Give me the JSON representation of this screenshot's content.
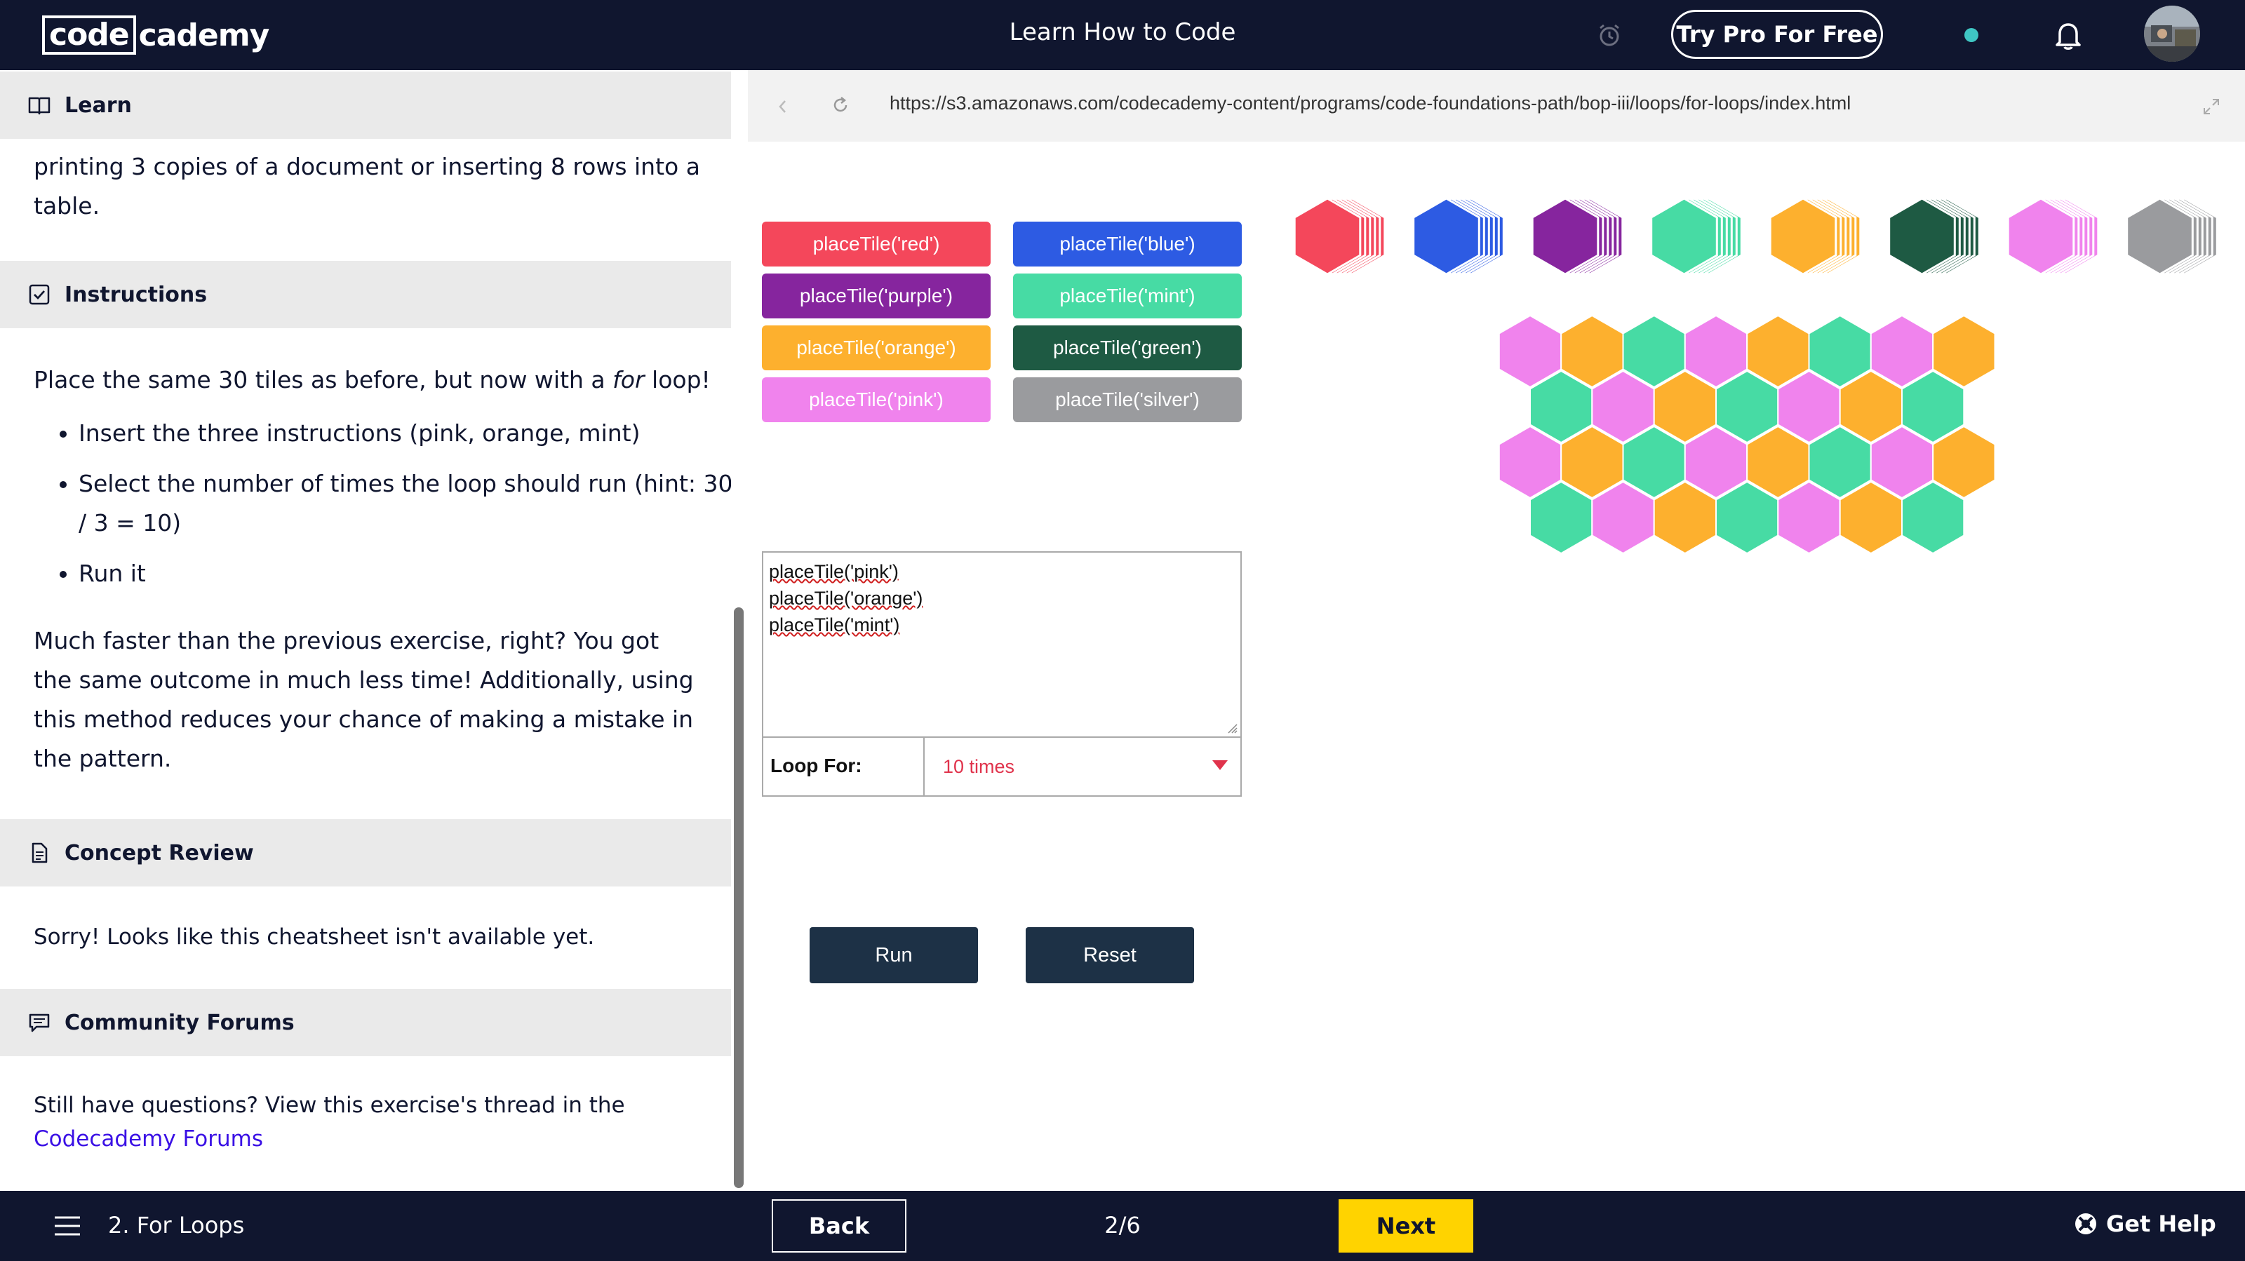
{
  "header": {
    "logo_left": "code",
    "logo_right": "cademy",
    "title": "Learn How to Code",
    "try_pro": "Try Pro For Free"
  },
  "learn": {
    "heading": "Learn",
    "text_line1": "printing 3 copies of a document or inserting 8 rows into a",
    "text_line2": "table."
  },
  "instructions": {
    "heading": "Instructions",
    "intro_before": "Place the same 30 tiles as before, but now with a ",
    "intro_italic": "for",
    "intro_after": " loop!",
    "bullets": [
      "Insert the three instructions (pink, orange, mint)",
      "Select the number of times the loop should run (hint: 30 / 3 = 10)",
      "Run it"
    ],
    "followup": "Much faster than the previous exercise, right? You got the same outcome in much less time! Additionally, using this method reduces your chance of making a mistake in the pattern."
  },
  "concept_review": {
    "heading": "Concept Review",
    "text": "Sorry! Looks like this cheatsheet isn't available yet."
  },
  "community": {
    "heading": "Community Forums",
    "text": "Still have questions? View this exercise's thread in the",
    "link": "Codecademy Forums"
  },
  "browser": {
    "url": "https://s3.amazonaws.com/codecademy-content/programs/code-foundations-path/bop-iii/loops/for-loops/index.html"
  },
  "tile_buttons": [
    {
      "label": "placeTile('red')",
      "color": "#f4475b"
    },
    {
      "label": "placeTile('blue')",
      "color": "#2d5be3"
    },
    {
      "label": "placeTile('purple')",
      "color": "#86259e"
    },
    {
      "label": "placeTile('mint')",
      "color": "#47dba4"
    },
    {
      "label": "placeTile('orange')",
      "color": "#fdb02e"
    },
    {
      "label": "placeTile('green')",
      "color": "#1e5a43"
    },
    {
      "label": "placeTile('pink')",
      "color": "#f083ed"
    },
    {
      "label": "placeTile('silver')",
      "color": "#9a9b9e"
    }
  ],
  "tile_stack_colors": [
    "#f4475b",
    "#2d5be3",
    "#86259e",
    "#47dba4",
    "#fdb02e",
    "#1e5a43",
    "#f083ed",
    "#9a9b9e"
  ],
  "honeycomb_rows": [
    [
      "pink",
      "orange",
      "mint",
      "pink",
      "orange",
      "mint",
      "pink",
      "orange"
    ],
    [
      "mint",
      "pink",
      "orange",
      "mint",
      "pink",
      "orange",
      "mint"
    ],
    [
      "pink",
      "orange",
      "mint",
      "pink",
      "orange",
      "mint",
      "pink",
      "orange"
    ],
    [
      "mint",
      "pink",
      "orange",
      "mint",
      "pink",
      "orange",
      "mint"
    ]
  ],
  "colors": {
    "pink": "#f083ed",
    "orange": "#fdb02e",
    "mint": "#47dba4"
  },
  "editor": {
    "lines": [
      "placeTile('pink')",
      "placeTile('orange')",
      "placeTile('mint')"
    ],
    "loop_label": "Loop For:",
    "loop_value": "10 times"
  },
  "actions": {
    "run": "Run",
    "reset": "Reset"
  },
  "footer": {
    "lesson": "2. For Loops",
    "back": "Back",
    "progress": "2/6",
    "next": "Next",
    "help": "Get Help"
  }
}
